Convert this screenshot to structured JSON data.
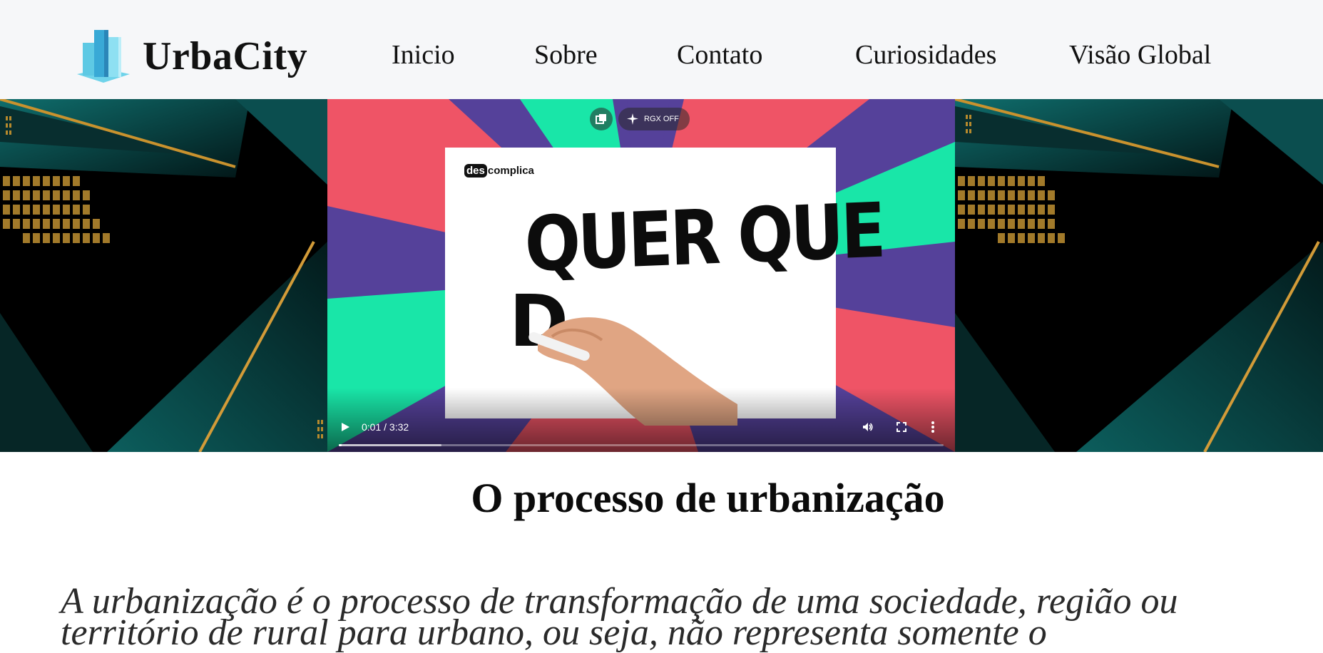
{
  "header": {
    "brand": "UrbaCity",
    "logo_icon": "city-buildings-logo",
    "nav": [
      {
        "label": "Inicio"
      },
      {
        "label": "Sobre"
      },
      {
        "label": "Contato"
      },
      {
        "label": "Curiosidades"
      },
      {
        "label": "Visão Global"
      }
    ]
  },
  "video": {
    "rgx_label": "RGX OFF",
    "channel_badge_prefix": "des",
    "channel_badge_suffix": "complica",
    "handwriting_text": "QUER QUE",
    "handwriting_partial": "D",
    "time": "0:01 / 3:32",
    "progress_fraction": 0.0047,
    "buffered_fraction": 0.17,
    "icons": [
      "play-icon",
      "volume-icon",
      "fullscreen-icon",
      "more-options-icon",
      "picture-in-picture-icon",
      "sparkle-icon"
    ]
  },
  "colors": {
    "header_bg": "#f6f7f9",
    "logo_blue": "#3fb6d8",
    "panel_teal": "#0e5c5c",
    "panel_gold": "#c9922e",
    "video_purple": "#55419a",
    "video_green": "#19e6a8",
    "video_red": "#ef5466"
  },
  "section": {
    "title": "O processo de urbanização",
    "paragraph": "A urbanização é o processo de transformação de uma sociedade, região ou território de rural para urbano, ou seja, não representa somente o"
  }
}
